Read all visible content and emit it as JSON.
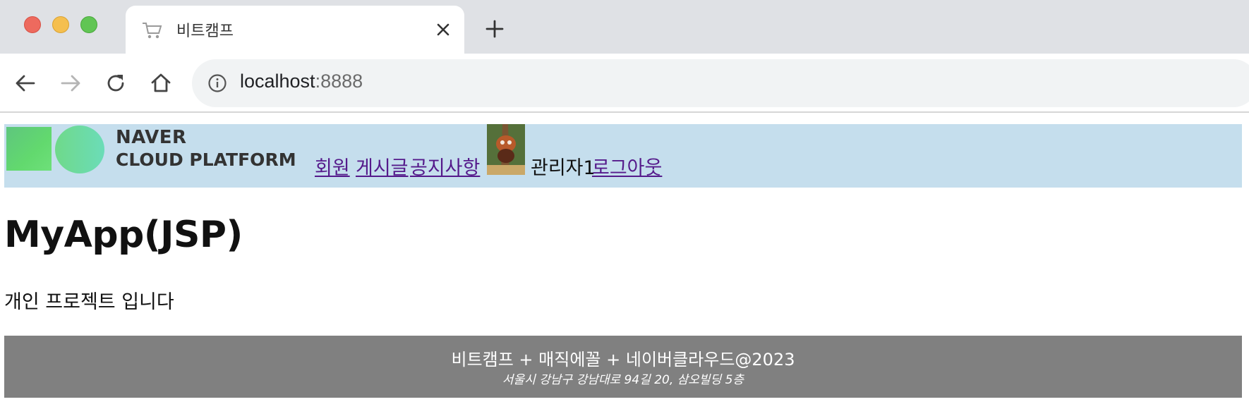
{
  "browser": {
    "tab_title": "비트캠프",
    "url_host": "localhost",
    "url_port": ":8888"
  },
  "header": {
    "logo": {
      "line1": "NAVER",
      "line2": "CLOUD PLATFORM"
    },
    "menu": [
      "회원",
      "게시글",
      "공지사항"
    ],
    "user_name": "관리자1",
    "logout_label": "로그아웃"
  },
  "main": {
    "title": "MyApp(JSP)",
    "intro": "개인 프로젝트 입니다"
  },
  "footer": {
    "line1": "비트캠프 + 매직에꼴 + 네이버클라우드@2023",
    "line2": "서울시 강남구 강남대로 94길 20, 삼오빌딩 5층"
  },
  "colors": {
    "header_bg": "#c5deed",
    "footer_bg": "#808080",
    "link": "#551a8b"
  }
}
